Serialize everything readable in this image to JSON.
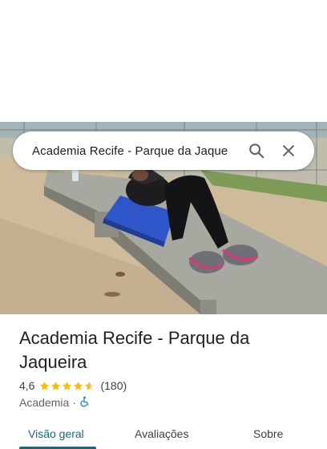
{
  "search": {
    "query": "Academia Recife - Parque da Jaque"
  },
  "place": {
    "title": "Academia Recife - Parque da Jaqueira",
    "rating": "4,6",
    "rating_value": 4.6,
    "reviews": "(180)",
    "category": "Academia",
    "separator": "·"
  },
  "tabs": [
    {
      "label": "Visão geral",
      "active": true
    },
    {
      "label": "Avaliações",
      "active": false
    },
    {
      "label": "Sobre",
      "active": false
    }
  ],
  "colors": {
    "star": "#fbbc04",
    "accent": "#0b6b87",
    "accessibility": "#1a73e8"
  },
  "icons": {
    "search": "search-icon",
    "close": "close-icon",
    "star": "star-icon",
    "accessibility": "wheelchair-icon"
  }
}
